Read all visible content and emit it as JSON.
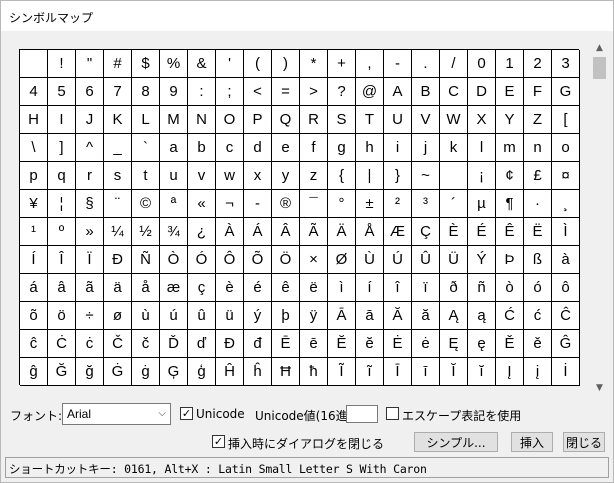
{
  "window": {
    "title": "シンボルマップ"
  },
  "grid": {
    "rows": [
      [
        " ",
        "!",
        "\"",
        "#",
        "$",
        "%",
        "&",
        "'",
        "(",
        ")",
        "*",
        "+",
        ",",
        "-",
        ".",
        "/",
        "0",
        "1",
        "2",
        "3"
      ],
      [
        "4",
        "5",
        "6",
        "7",
        "8",
        "9",
        ":",
        ";",
        "<",
        "=",
        ">",
        "?",
        "@",
        "A",
        "B",
        "C",
        "D",
        "E",
        "F",
        "G"
      ],
      [
        "H",
        "I",
        "J",
        "K",
        "L",
        "M",
        "N",
        "O",
        "P",
        "Q",
        "R",
        "S",
        "T",
        "U",
        "V",
        "W",
        "X",
        "Y",
        "Z",
        "["
      ],
      [
        "\\",
        "]",
        "^",
        "_",
        "`",
        "a",
        "b",
        "c",
        "d",
        "e",
        "f",
        "g",
        "h",
        "i",
        "j",
        "k",
        "l",
        "m",
        "n",
        "o"
      ],
      [
        "p",
        "q",
        "r",
        "s",
        "t",
        "u",
        "v",
        "w",
        "x",
        "y",
        "z",
        "{",
        "|",
        "}",
        "~",
        " ",
        "¡",
        "¢",
        "£",
        "¤"
      ],
      [
        "¥",
        "¦",
        "§",
        "¨",
        "©",
        "ª",
        "«",
        "¬",
        "-",
        "®",
        "¯",
        "°",
        "±",
        "²",
        "³",
        "´",
        "µ",
        "¶",
        "·",
        "¸"
      ],
      [
        "¹",
        "º",
        "»",
        "¼",
        "½",
        "¾",
        "¿",
        "À",
        "Á",
        "Â",
        "Ã",
        "Ä",
        "Å",
        "Æ",
        "Ç",
        "È",
        "É",
        "Ê",
        "Ë",
        "Ì"
      ],
      [
        "Í",
        "Î",
        "Ï",
        "Ð",
        "Ñ",
        "Ò",
        "Ó",
        "Ô",
        "Õ",
        "Ö",
        "×",
        "Ø",
        "Ù",
        "Ú",
        "Û",
        "Ü",
        "Ý",
        "Þ",
        "ß",
        "à"
      ],
      [
        "á",
        "â",
        "ã",
        "ä",
        "å",
        "æ",
        "ç",
        "è",
        "é",
        "ê",
        "ë",
        "ì",
        "í",
        "î",
        "ï",
        "ð",
        "ñ",
        "ò",
        "ó",
        "ô"
      ],
      [
        "õ",
        "ö",
        "÷",
        "ø",
        "ù",
        "ú",
        "û",
        "ü",
        "ý",
        "þ",
        "ÿ",
        "Ā",
        "ā",
        "Ă",
        "ă",
        "Ą",
        "ą",
        "Ć",
        "ć",
        "Ĉ"
      ],
      [
        "ĉ",
        "Ċ",
        "ċ",
        "Č",
        "č",
        "Ď",
        "ď",
        "Đ",
        "đ",
        "Ē",
        "ē",
        "Ĕ",
        "ĕ",
        "Ė",
        "ė",
        "Ę",
        "ę",
        "Ě",
        "ě",
        "Ĝ"
      ],
      [
        "ĝ",
        "Ğ",
        "ğ",
        "Ġ",
        "ġ",
        "Ģ",
        "ģ",
        "Ĥ",
        "ĥ",
        "Ħ",
        "ħ",
        "Ĩ",
        "ĩ",
        "Ī",
        "ī",
        "Ĭ",
        "ĭ",
        "Į",
        "į",
        "İ"
      ]
    ]
  },
  "controls": {
    "font_label": "フォント:",
    "font_value": "Arial",
    "unicode_checkbox_label": "Unicode",
    "unicode_checked": true,
    "unicode_value_label": "Unicode値(16進)",
    "unicode_value": "",
    "escape_label": "エスケープ表記を使用",
    "escape_checked": false,
    "close_on_insert_label": "挿入時にダイアログを閉じる",
    "close_on_insert_checked": true,
    "simple_button": "シンプル...",
    "insert_button": "挿入",
    "close_button": "閉じる"
  },
  "status": {
    "text": "ショートカットキー: 0161, Alt+X : Latin Small Letter S With Caron"
  },
  "icons": {
    "checkmark": "✓",
    "dropdown": "chevron-down-icon",
    "scroll_up": "▲",
    "scroll_down": "▼"
  }
}
